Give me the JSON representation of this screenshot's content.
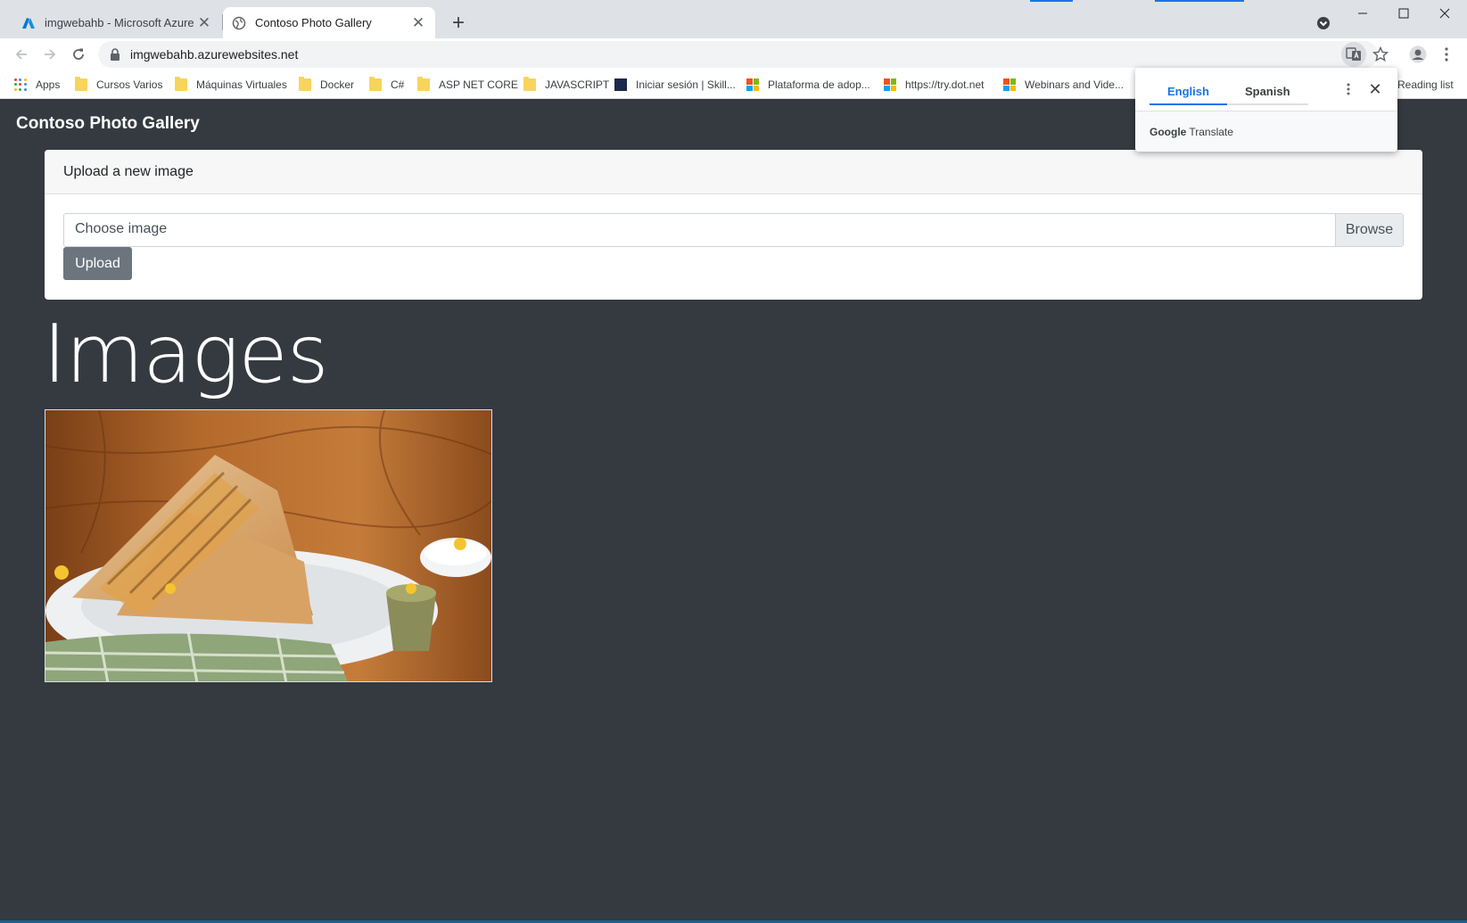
{
  "browser": {
    "tabs": [
      {
        "title": "imgwebahb - Microsoft Azure",
        "icon": "azure-icon",
        "active": false
      },
      {
        "title": "Contoso Photo Gallery",
        "icon": "globe-icon",
        "active": true
      }
    ],
    "url": "imgwebahb.azurewebsites.net",
    "bookmarks": [
      {
        "label": "Apps",
        "icon": "apps-grid-icon"
      },
      {
        "label": "Cursos Varios",
        "icon": "folder-icon"
      },
      {
        "label": "Máquinas Virtuales",
        "icon": "folder-icon"
      },
      {
        "label": "Docker",
        "icon": "folder-icon"
      },
      {
        "label": "C#",
        "icon": "folder-icon"
      },
      {
        "label": "ASP NET CORE",
        "icon": "folder-icon"
      },
      {
        "label": "JAVASCRIPT",
        "icon": "folder-icon"
      },
      {
        "label": "Iniciar sesión | Skill...",
        "icon": "skillsoft-icon"
      },
      {
        "label": "Plataforma de adop...",
        "icon": "microsoft-icon"
      },
      {
        "label": "https://try.dot.net",
        "icon": "microsoft-icon"
      },
      {
        "label": "Webinars and Vide...",
        "icon": "microsoft-icon"
      }
    ],
    "reading_list": "Reading list",
    "accent_color": "#1a73e8"
  },
  "translate_popup": {
    "languages": [
      "English",
      "Spanish"
    ],
    "selected": "English",
    "footer_brand": "Google",
    "footer_product": "Translate"
  },
  "page": {
    "brand": "Contoso Photo Gallery",
    "upload_card": {
      "header": "Upload a new image",
      "file_placeholder": "Choose image",
      "browse_label": "Browse",
      "upload_label": "Upload"
    },
    "images_heading": "Images",
    "background_color": "#343a40",
    "upload_button_color": "#6c757d"
  }
}
